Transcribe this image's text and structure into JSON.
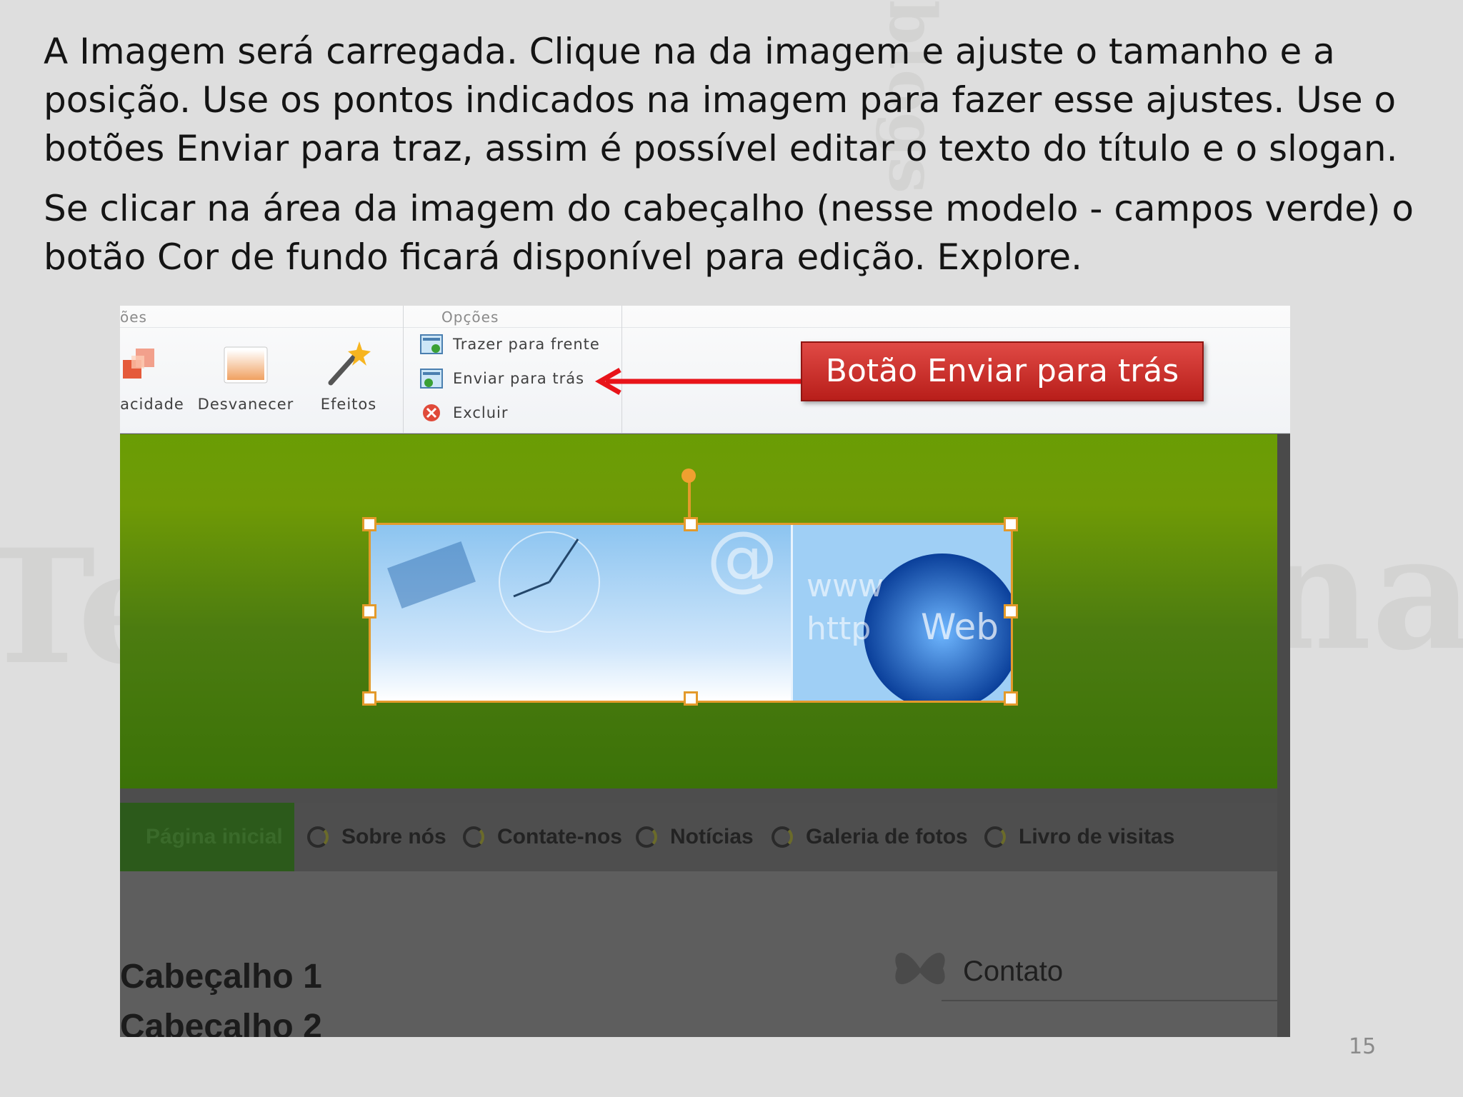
{
  "slide": {
    "paragraph1": "A Imagem será carregada. Clique na da imagem e ajuste o tamanho e a posição. Use os pontos indicados na imagem para fazer esse ajustes.  Use o botões Enviar para traz, assim é possível editar o texto do título e o slogan.",
    "paragraph2": "Se clicar na área da imagem do cabeçalho (nesse modelo - campos verde) o botão Cor de fundo ficará disponível  para edição. Explore.",
    "page_number": "15",
    "callout": "Botão Enviar para trás"
  },
  "ribbon": {
    "group_left_title": "ões",
    "group_options_title": "Opções",
    "buttons": [
      {
        "label": "acidade",
        "icon": "transparency-icon"
      },
      {
        "label": "Desvanecer",
        "icon": "fade-icon"
      },
      {
        "label": "Efeitos",
        "icon": "magic-wand-icon"
      }
    ],
    "options": [
      {
        "label": "Trazer para frente",
        "icon": "bring-forward-icon"
      },
      {
        "label": "Enviar para trás",
        "icon": "send-backward-icon"
      },
      {
        "label": "Excluir",
        "icon": "delete-icon"
      }
    ]
  },
  "site": {
    "banner_text_www": "www",
    "banner_text_http": "http",
    "banner_text_web": "Web",
    "nav": [
      "Página inicial",
      "Sobre nós",
      "Contate-nos",
      "Notícias",
      "Galeria de fotos",
      "Livro de visitas"
    ],
    "heading1": "Cabeçalho 1",
    "heading2": "Cabeçalho 2",
    "contact": "Contato"
  },
  "colors": {
    "header_green": "#6a9d05",
    "selection_orange": "#e39a2b",
    "callout_red": "#c9302c",
    "arrow_red": "#e8141a"
  }
}
